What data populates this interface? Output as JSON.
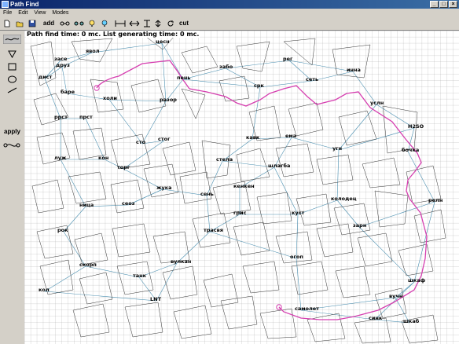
{
  "window": {
    "title": "Path Find",
    "min": "_",
    "max": "□",
    "close": "×"
  },
  "menu": [
    "File",
    "Edit",
    "View",
    "Modes"
  ],
  "toolbar": {
    "add_label": "add",
    "cut_label": "cut"
  },
  "left_panel": {
    "apply_label": "apply"
  },
  "status": {
    "text": "Path find time: 0 mc. List generating time: 0 mc."
  },
  "colors": {
    "path": "#d63fb0",
    "edges": "#4a8fb0",
    "grid": "#808080"
  },
  "map": {
    "nodes": [
      {
        "label": "засе"
      },
      {
        "label": "явол"
      },
      {
        "label": "цесн"
      },
      {
        "label": "пень"
      },
      {
        "label": "забо"
      },
      {
        "label": "рег"
      },
      {
        "label": "инна"
      },
      {
        "label": "сеть"
      },
      {
        "label": "дист"
      },
      {
        "label": "друз"
      },
      {
        "label": "баре"
      },
      {
        "label": "холи"
      },
      {
        "label": "разор"
      },
      {
        "label": "срк"
      },
      {
        "label": "услн"
      },
      {
        "label": "H2SO"
      },
      {
        "label": "ррст"
      },
      {
        "label": "прст"
      },
      {
        "label": "бочка"
      },
      {
        "label": "кавк"
      },
      {
        "label": "ема"
      },
      {
        "label": "угн"
      },
      {
        "label": "сто"
      },
      {
        "label": "стог"
      },
      {
        "label": "луж"
      },
      {
        "label": "кон"
      },
      {
        "label": "торг"
      },
      {
        "label": "стела"
      },
      {
        "label": "шлагба"
      },
      {
        "label": "жука"
      },
      {
        "label": "кенкен"
      },
      {
        "label": "сень"
      },
      {
        "label": "ница"
      },
      {
        "label": "сеоз"
      },
      {
        "label": "грис"
      },
      {
        "label": "куст"
      },
      {
        "label": "колодец"
      },
      {
        "label": "релн"
      },
      {
        "label": "рок"
      },
      {
        "label": "трасвя"
      },
      {
        "label": "зарн"
      },
      {
        "label": "скорп"
      },
      {
        "label": "вулкан"
      },
      {
        "label": "огоп"
      },
      {
        "label": "танк"
      },
      {
        "label": "шкаф"
      },
      {
        "label": "кол"
      },
      {
        "label": "LNT"
      },
      {
        "label": "самолет"
      },
      {
        "label": "вучн"
      },
      {
        "label": "синк"
      },
      {
        "label": "шкаб"
      }
    ]
  }
}
